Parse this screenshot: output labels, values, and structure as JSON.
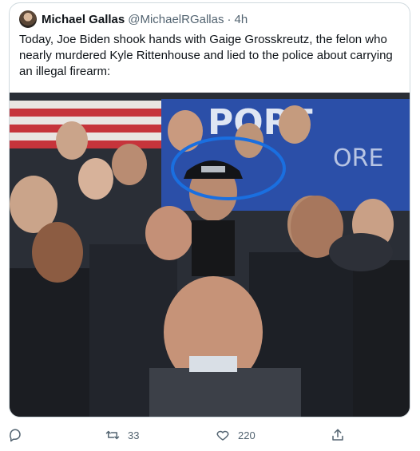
{
  "tweet": {
    "author_name": "Michael Gallas",
    "handle": "@MichaelRGallas",
    "separator": "·",
    "time": "4h",
    "text": "Today, Joe Biden shook hands with Gaige Grosskreutz, the felon who nearly murdered Kyle Rittenhouse and lied to the police about carrying an illegal firearm:"
  },
  "media": {
    "background_sign_text": "PORT",
    "background_sign_sub": "ORE",
    "highlight_color": "#1a6fe0"
  },
  "actions": {
    "reply_icon": "reply-icon",
    "retweet_icon": "retweet-icon",
    "retweet_count": "33",
    "like_icon": "heart-icon",
    "like_count": "220",
    "share_icon": "share-icon"
  },
  "colors": {
    "text": "#0f1419",
    "secondary": "#536471",
    "border": "#cfd9de"
  }
}
